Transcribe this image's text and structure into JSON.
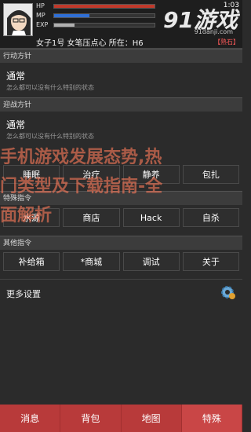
{
  "header": {
    "clock": "1:03",
    "stats": [
      {
        "label": "HP",
        "fill_pct": 100,
        "color": "#c0392b"
      },
      {
        "label": "MP",
        "fill_pct": 35,
        "color": "#2f6fd6"
      },
      {
        "label": "EXP",
        "fill_pct": 20,
        "color": "#b0b0b0"
      }
    ],
    "info": "女子1号 女笔压点心 所在：H6",
    "corner_tag": "【熟石】"
  },
  "sections": {
    "action_policy": {
      "title": "行动方针",
      "name": "通常",
      "desc": "怎么都可以没有什么特别的状态"
    },
    "intercept_policy": {
      "title": "迎战方针",
      "name": "通常",
      "desc": "怎么都可以没有什么特别的状态"
    }
  },
  "rows": {
    "row1": [
      "睡眠",
      "治疗",
      "静养",
      "包扎"
    ],
    "special_title": "特殊指令",
    "row2": [
      "水源",
      "商店",
      "Hack",
      "自杀"
    ],
    "other_title": "其他指令",
    "row3": [
      "补给箱",
      "*商城",
      "调试",
      "关于"
    ]
  },
  "more_settings": "更多设置",
  "watermark": {
    "line1": "手机游戏发展态势,热",
    "line2": "门类型及下载指南-全",
    "line3": "面解析",
    "logo_big": "91游戏",
    "logo_small": "91danji.com"
  },
  "tabs": [
    "消息",
    "背包",
    "地图",
    "特殊"
  ],
  "colors": {
    "tab_bar": "#b83a3a",
    "watermark": "#ff7b5a"
  }
}
